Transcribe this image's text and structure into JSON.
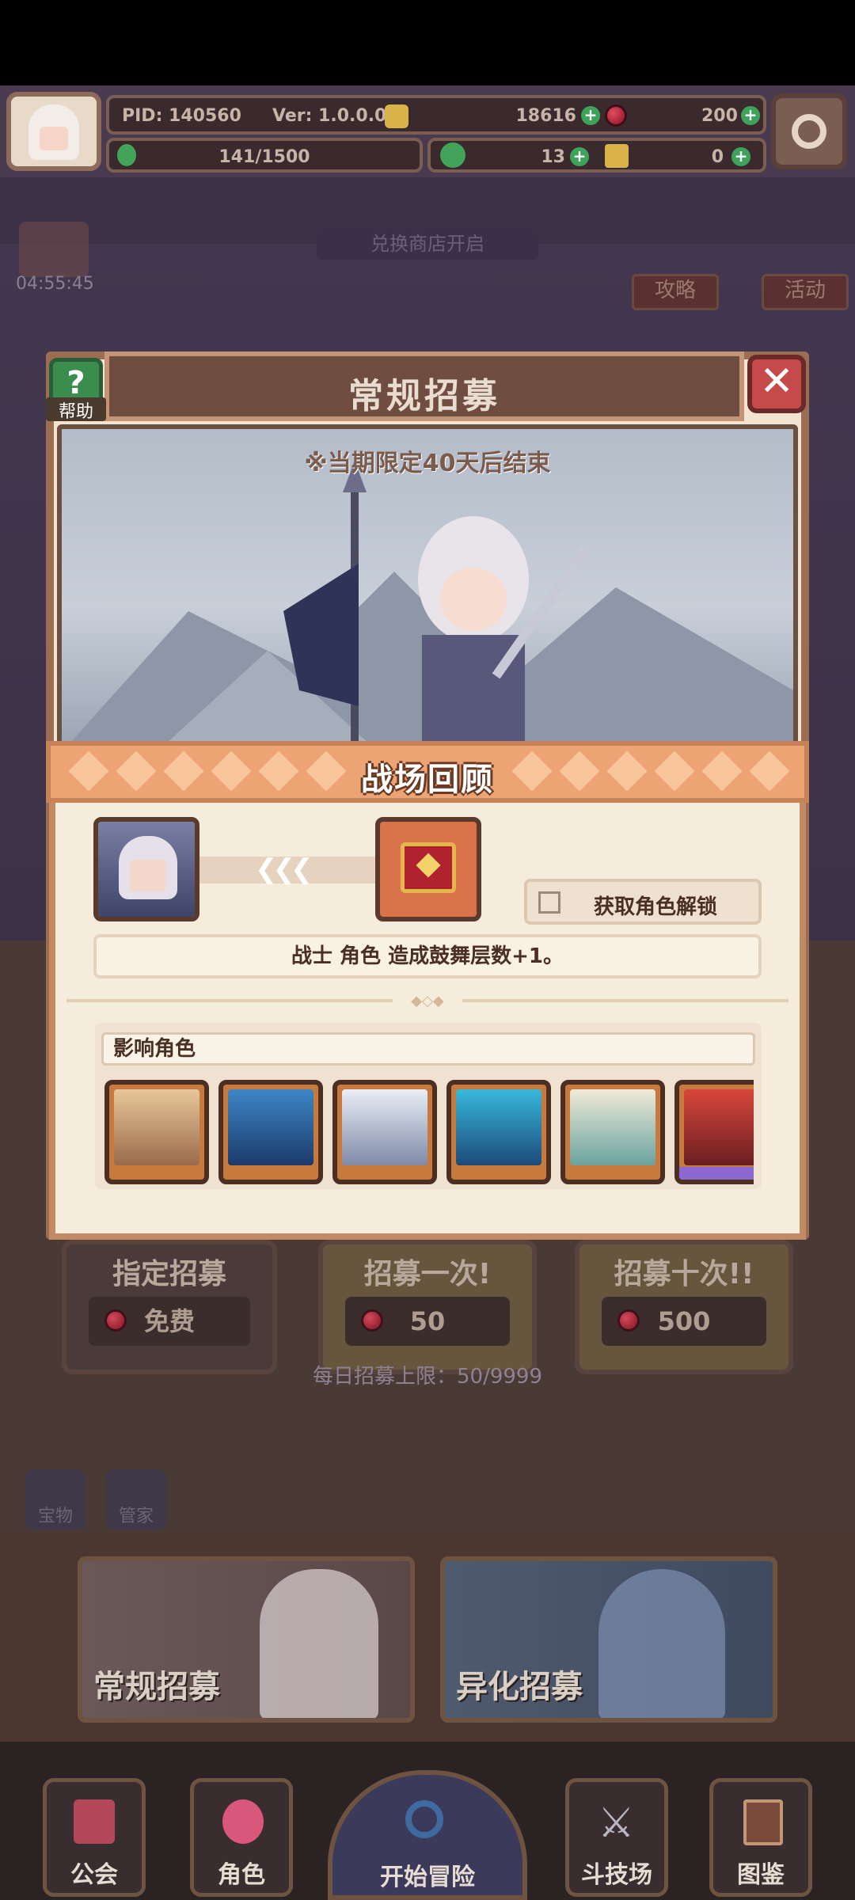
{
  "topbar": {
    "pid": "PID: 140560",
    "version": "Ver: 1.0.0.0",
    "gold": "18616",
    "gems": "200",
    "stamina": "141/1500",
    "clover": "13",
    "keys": "0"
  },
  "background": {
    "timer": "04:55:45",
    "shop_banner": "兑换商店开启",
    "guide": "攻略",
    "event": "活动"
  },
  "panel": {
    "title": "常规招募",
    "help": "帮助",
    "limit_notice": "※当期限定40天后结束"
  },
  "recall": {
    "title": "战场回顾",
    "unlock_label": "获取角色解锁",
    "effect": "战士 角色 造成鼓舞层数+1。",
    "affected_label": "影响角色"
  },
  "recruit": {
    "designated_label": "指定招募",
    "designated_price": "免费",
    "once_label": "招募一次!",
    "once_price": "50",
    "ten_label": "招募十次!!",
    "ten_price": "500",
    "daily_limit": "每日招募上限：50/9999"
  },
  "side": {
    "left1": "宝物",
    "left2": "管家"
  },
  "tabs": {
    "normal": "常规招募",
    "alien": "异化招募"
  },
  "nav": {
    "guild": "公会",
    "character": "角色",
    "adventure": "开始冒险",
    "arena": "斗技场",
    "codex": "图鉴"
  },
  "colors": {
    "panel_bg": "#f3e4d1",
    "header_orange": "#eda474",
    "frame_brown": "#9b6e54"
  }
}
